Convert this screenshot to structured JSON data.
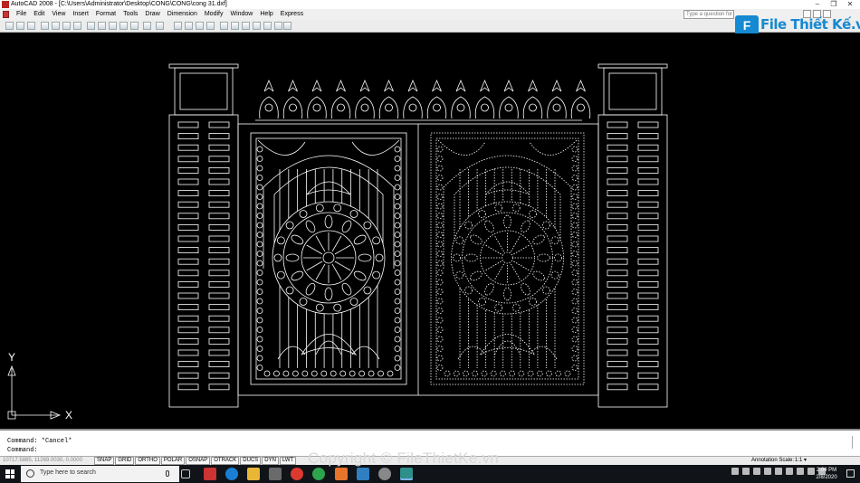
{
  "window": {
    "title": "AutoCAD 2008 - [C:\\Users\\Administrator\\Desktop\\CONG\\CONG\\cong 31.dxf]",
    "controls": [
      "–",
      "❐",
      "✕"
    ]
  },
  "menubar": {
    "items": [
      "File",
      "Edit",
      "View",
      "Insert",
      "Format",
      "Tools",
      "Draw",
      "Dimension",
      "Modify",
      "Window",
      "Help",
      "Express"
    ],
    "help_search_placeholder": "Type a question for help"
  },
  "logo": {
    "letter": "F",
    "text": "File Thiết Kế.vn",
    "color": "#1589d1"
  },
  "drawing": {
    "background": "#000000",
    "line_color": "#ffffff",
    "ucs": {
      "x_label": "X",
      "y_label": "Y"
    }
  },
  "command": {
    "line1": "Command: *Cancel*",
    "line2": "Command:"
  },
  "status": {
    "coordinates": "10717.5885, 11269.0030, 0.0000",
    "toggles": [
      "SNAP",
      "GRID",
      "ORTHO",
      "POLAR",
      "OSNAP",
      "OTRACK",
      "DUCS",
      "DYN",
      "LWT"
    ],
    "annotation_scale_label": "Annotation Scale:",
    "annotation_scale_value": "1:1 ▾"
  },
  "taskbar": {
    "search_placeholder": "Type here to search",
    "time": "2:04 PM",
    "date": "2/8/2020"
  },
  "watermark": "Copyright © FileThietKe.vn"
}
